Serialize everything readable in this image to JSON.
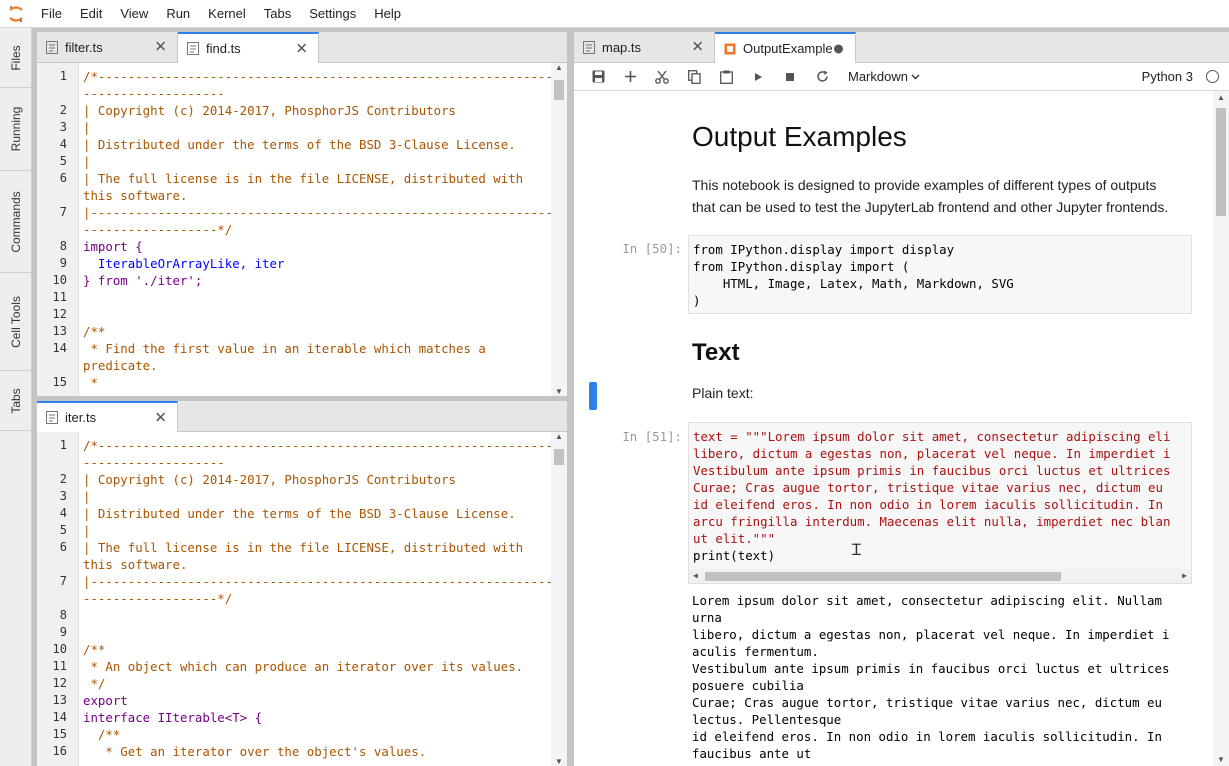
{
  "menu": [
    "File",
    "Edit",
    "View",
    "Run",
    "Kernel",
    "Tabs",
    "Settings",
    "Help"
  ],
  "sidebar": [
    "Files",
    "Running",
    "Commands",
    "Cell Tools",
    "Tabs"
  ],
  "editor_top": {
    "tabs": [
      {
        "label": "filter.ts",
        "active": false
      },
      {
        "label": "find.ts",
        "active": true
      }
    ],
    "lines": [
      {
        "n": "1",
        "t": "/*-----------------------------------------------------------------",
        "c": "cm-comment"
      },
      {
        "n": "",
        "t": "-------------------",
        "c": "cm-comment"
      },
      {
        "n": "2",
        "t": "| Copyright (c) 2014-2017, PhosphorJS Contributors",
        "c": "cm-comment"
      },
      {
        "n": "3",
        "t": "|",
        "c": "cm-comment"
      },
      {
        "n": "4",
        "t": "| Distributed under the terms of the BSD 3-Clause License.",
        "c": "cm-comment"
      },
      {
        "n": "5",
        "t": "|",
        "c": "cm-comment"
      },
      {
        "n": "6",
        "t": "| The full license is in the file LICENSE, distributed with",
        "c": "cm-comment"
      },
      {
        "n": "",
        "t": "this software.",
        "c": "cm-comment"
      },
      {
        "n": "7",
        "t": "|-----------------------------------------------------------------",
        "c": "cm-comment"
      },
      {
        "n": "",
        "t": "------------------*/",
        "c": "cm-comment"
      },
      {
        "n": "8",
        "t": "import {",
        "c": "cm-keyword"
      },
      {
        "n": "9",
        "t": "  IterableOrArrayLike, iter",
        "c": "cm-def"
      },
      {
        "n": "10",
        "t": "} from './iter';",
        "c": "cm-keyword"
      },
      {
        "n": "11",
        "t": "",
        "c": "cm-plain"
      },
      {
        "n": "12",
        "t": "",
        "c": "cm-plain"
      },
      {
        "n": "13",
        "t": "/**",
        "c": "cm-comment"
      },
      {
        "n": "14",
        "t": " * Find the first value in an iterable which matches a",
        "c": "cm-comment"
      },
      {
        "n": "",
        "t": "predicate.",
        "c": "cm-comment"
      },
      {
        "n": "15",
        "t": " *",
        "c": "cm-comment"
      }
    ]
  },
  "editor_bottom": {
    "tabs": [
      {
        "label": "iter.ts",
        "active": true
      }
    ],
    "lines": [
      {
        "n": "1",
        "t": "/*-----------------------------------------------------------------",
        "c": "cm-comment"
      },
      {
        "n": "",
        "t": "-------------------",
        "c": "cm-comment"
      },
      {
        "n": "2",
        "t": "| Copyright (c) 2014-2017, PhosphorJS Contributors",
        "c": "cm-comment"
      },
      {
        "n": "3",
        "t": "|",
        "c": "cm-comment"
      },
      {
        "n": "4",
        "t": "| Distributed under the terms of the BSD 3-Clause License.",
        "c": "cm-comment"
      },
      {
        "n": "5",
        "t": "|",
        "c": "cm-comment"
      },
      {
        "n": "6",
        "t": "| The full license is in the file LICENSE, distributed with",
        "c": "cm-comment"
      },
      {
        "n": "",
        "t": "this software.",
        "c": "cm-comment"
      },
      {
        "n": "7",
        "t": "|-----------------------------------------------------------------",
        "c": "cm-comment"
      },
      {
        "n": "",
        "t": "------------------*/",
        "c": "cm-comment"
      },
      {
        "n": "8",
        "t": "",
        "c": "cm-plain"
      },
      {
        "n": "9",
        "t": "",
        "c": "cm-plain"
      },
      {
        "n": "10",
        "t": "/**",
        "c": "cm-comment"
      },
      {
        "n": "11",
        "t": " * An object which can produce an iterator over its values.",
        "c": "cm-comment"
      },
      {
        "n": "12",
        "t": " */",
        "c": "cm-comment"
      },
      {
        "n": "13",
        "t": "export",
        "c": "cm-keyword"
      },
      {
        "n": "14",
        "t": "interface IIterable<T> {",
        "c": "cm-keyword"
      },
      {
        "n": "15",
        "t": "  /**",
        "c": "cm-comment"
      },
      {
        "n": "16",
        "t": "   * Get an iterator over the object's values.",
        "c": "cm-comment"
      }
    ]
  },
  "notebook": {
    "tabs": [
      {
        "label": "map.ts",
        "active": false
      },
      {
        "label": "OutputExample",
        "active": true
      }
    ],
    "celltype": "Markdown",
    "kernel": "Python 3",
    "title": "Output Examples",
    "intro": [
      "This notebook is designed to provide examples of different types of outputs",
      "that can be used to test the JupyterLab frontend and other Jupyter frontends."
    ],
    "cell1": {
      "prompt": "In [50]:",
      "lines": [
        "from IPython.display import display",
        "from IPython.display import (",
        "    HTML, Image, Latex, Math, Markdown, SVG",
        ")"
      ]
    },
    "heading2": "Text",
    "plain_text": "Plain text:",
    "cell2": {
      "prompt": "In [51]:",
      "lines": [
        "text = \"\"\"Lorem ipsum dolor sit amet, consectetur adipiscing eli",
        "libero, dictum a egestas non, placerat vel neque. In imperdiet i",
        "Vestibulum ante ipsum primis in faucibus orci luctus et ultrices",
        "Curae; Cras augue tortor, tristique vitae varius nec, dictum eu",
        "id eleifend eros. In non odio in lorem iaculis sollicitudin. In",
        "arcu fringilla interdum. Maecenas elit nulla, imperdiet nec blan",
        "ut elit.\"\"\"",
        "print(text)"
      ]
    },
    "output": [
      "Lorem ipsum dolor sit amet, consectetur adipiscing elit. Nullam",
      "urna",
      "libero, dictum a egestas non, placerat vel neque. In imperdiet i",
      "aculis fermentum.",
      "Vestibulum ante ipsum primis in faucibus orci luctus et ultrices",
      "posuere cubilia",
      "Curae; Cras augue tortor, tristique vitae varius nec, dictum eu",
      "lectus. Pellentesque",
      "id eleifend eros. In non odio in lorem iaculis sollicitudin. In",
      "faucibus ante ut"
    ]
  },
  "colors": {
    "accent": "#2f80ed",
    "orange_logo": "#f37726"
  }
}
